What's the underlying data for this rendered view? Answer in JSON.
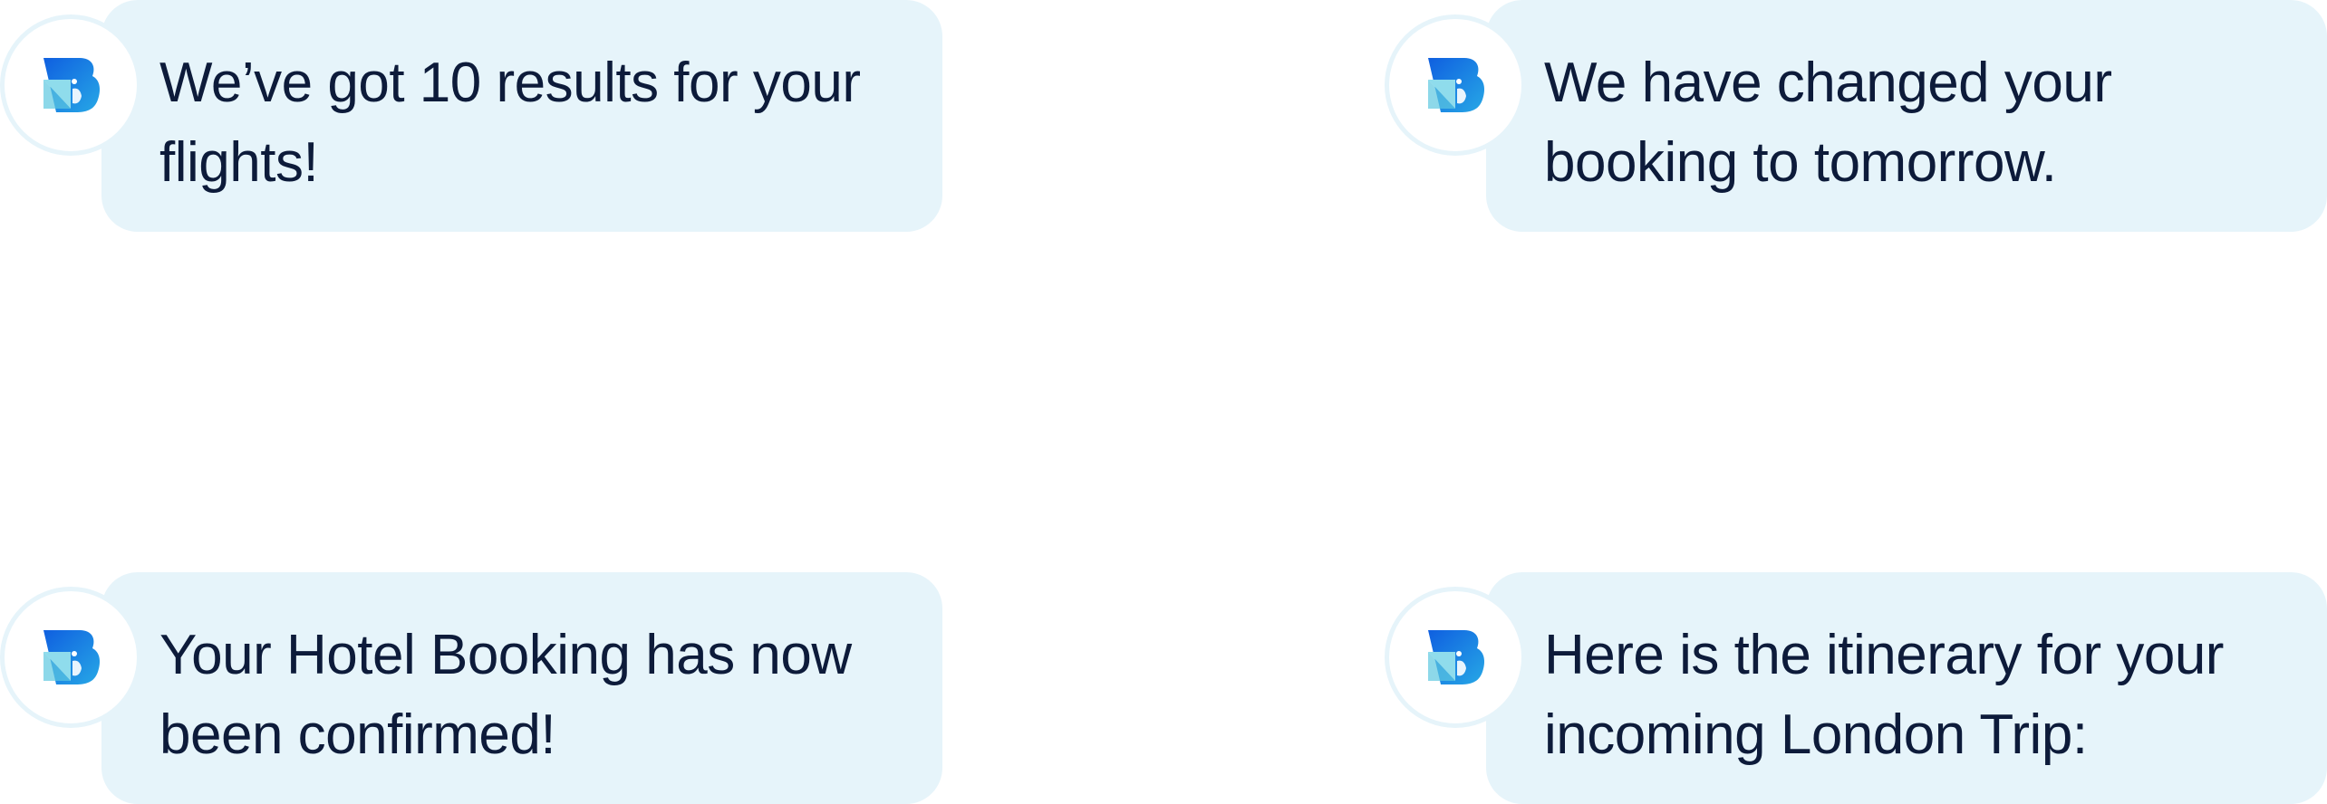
{
  "messages": [
    {
      "text": "We’ve got 10 results for your flights!"
    },
    {
      "text": "We have changed your booking to tomorrow."
    },
    {
      "text": "Your Hotel Booking has now been confirmed!"
    },
    {
      "text": "Here is the itinerary for your incoming London Trip:"
    }
  ],
  "avatar": {
    "icon": "brand-logo-b-icon"
  },
  "colors": {
    "bubble_background": "#e6f4fa",
    "text": "#0d1b3a",
    "avatar_border": "#e6f4fa",
    "logo_blue": "#1a73e8",
    "logo_light": "#7dd3e6"
  }
}
